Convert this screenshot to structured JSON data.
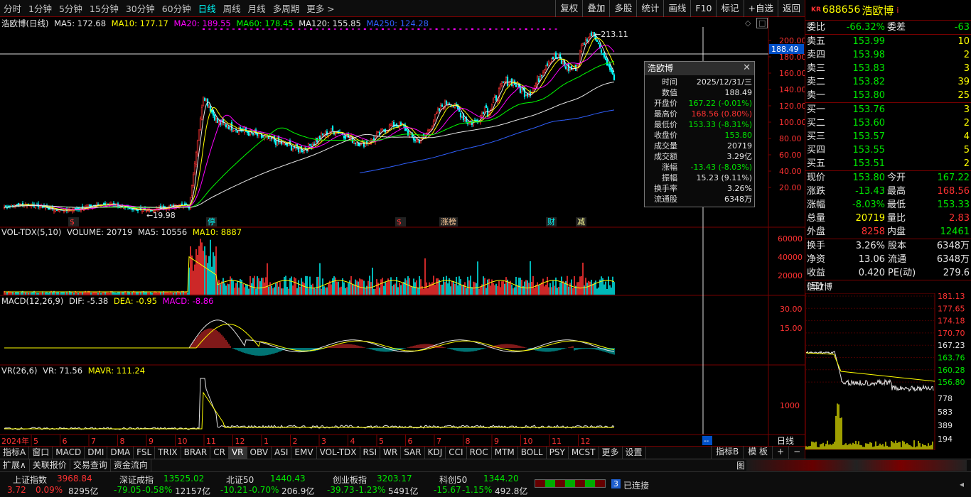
{
  "toolbar": {
    "periods": [
      "分时",
      "1分钟",
      "5分钟",
      "15分钟",
      "30分钟",
      "60分钟",
      "日线",
      "周线",
      "月线",
      "多周期",
      "更多 >"
    ],
    "active_period": "日线",
    "tools": [
      "复权",
      "叠加",
      "多股",
      "统计",
      "画线",
      "F10",
      "标记",
      "+自选",
      "返回"
    ]
  },
  "price_panel": {
    "stock_label": "浩欧博(日线)",
    "ma_labels": [
      {
        "text": "MA5: 172.68",
        "color": "#e6e6e6"
      },
      {
        "text": "MA10: 177.17",
        "color": "#ffff00"
      },
      {
        "text": "MA20: 189.55",
        "color": "#ff00ff"
      },
      {
        "text": "MA60: 178.45",
        "color": "#00ff00"
      },
      {
        "text": "MA120: 155.85",
        "color": "#e6e6e6"
      },
      {
        "text": "MA250: 124.28",
        "color": "#3060ff"
      }
    ],
    "y_ticks": [
      "200.00",
      "180.00",
      "160.00",
      "140.00",
      "120.00",
      "100.00",
      "80.00",
      "60.00",
      "40.00",
      "20.00"
    ],
    "crosshair_price": "188.49",
    "high_label": "213.11",
    "low_label": "19.98",
    "markers": [
      {
        "text": "$",
        "color": "#ff3232"
      },
      {
        "text": "停",
        "color": "#00ffff"
      },
      {
        "text": "$",
        "color": "#ff3232"
      },
      {
        "text": "涨榜",
        "color": "#ffcc99"
      },
      {
        "text": "财",
        "color": "#00ffff"
      },
      {
        "text": "减",
        "color": "#ffff99"
      }
    ]
  },
  "volume_panel": {
    "title": "VOL-TDX(5,10)",
    "labels": [
      {
        "text": "VOLUME: 20719",
        "color": "#e6e6e6"
      },
      {
        "text": "MA5: 10556",
        "color": "#e6e6e6"
      },
      {
        "text": "MA10: 8887",
        "color": "#ffff00"
      }
    ],
    "y_ticks": [
      "60000",
      "40000",
      "20000"
    ]
  },
  "macd_panel": {
    "title": "MACD(12,26,9)",
    "labels": [
      {
        "text": "DIF: -5.38",
        "color": "#e6e6e6"
      },
      {
        "text": "DEA: -0.95",
        "color": "#ffff00"
      },
      {
        "text": "MACD: -8.86",
        "color": "#ff00ff"
      }
    ],
    "y_ticks": [
      "30.00",
      "15.00"
    ]
  },
  "vr_panel": {
    "title": "VR(26,6)",
    "labels": [
      {
        "text": "VR: 71.56",
        "color": "#e6e6e6"
      },
      {
        "text": "MAVR: 111.24",
        "color": "#ffff00"
      }
    ],
    "y_ticks": [
      "1000"
    ]
  },
  "x_axis": {
    "year_label": "2024年",
    "months": [
      "5",
      "6",
      "7",
      "8",
      "9",
      "10",
      "11",
      "12",
      "1",
      "2",
      "3",
      "4",
      "5",
      "6",
      "7",
      "8",
      "9",
      "10",
      "11",
      "12"
    ],
    "period_label": "日线",
    "cursor_label": "--"
  },
  "tooltip": {
    "title": "浩欧博",
    "rows": [
      {
        "k": "时间",
        "v": "2025/12/31/三",
        "color": "#e6e6e6"
      },
      {
        "k": "数值",
        "v": "188.49",
        "color": "#e6e6e6"
      },
      {
        "k": "开盘价",
        "v": "167.22 (-0.01%)",
        "color": "#00e600"
      },
      {
        "k": "最高价",
        "v": "168.56 (0.80%)",
        "color": "#ff3232"
      },
      {
        "k": "最低价",
        "v": "153.33 (-8.31%)",
        "color": "#00e600"
      },
      {
        "k": "收盘价",
        "v": "153.80",
        "color": "#00e600"
      },
      {
        "k": "成交量",
        "v": "20719",
        "color": "#e6e6e6"
      },
      {
        "k": "成交额",
        "v": "3.29亿",
        "color": "#e6e6e6"
      },
      {
        "k": "涨幅",
        "v": "-13.43 (-8.03%)",
        "color": "#00e600"
      },
      {
        "k": "振幅",
        "v": "15.23 (9.11%)",
        "color": "#e6e6e6"
      },
      {
        "k": "换手率",
        "v": "3.26%",
        "color": "#e6e6e6"
      },
      {
        "k": "流通股",
        "v": "6348万",
        "color": "#e6e6e6"
      }
    ]
  },
  "right_panel": {
    "badge": "KR",
    "code": "688656",
    "name": "浩欧博",
    "info_icon": "i",
    "weibi": {
      "k": "委比",
      "v": "-66.32%",
      "k2": "委差",
      "v2": "-63"
    },
    "sell": [
      {
        "k": "卖五",
        "price": "153.99",
        "vol": "10"
      },
      {
        "k": "卖四",
        "price": "153.98",
        "vol": "2"
      },
      {
        "k": "卖三",
        "price": "153.83",
        "vol": "3"
      },
      {
        "k": "卖二",
        "price": "153.82",
        "vol": "39"
      },
      {
        "k": "卖一",
        "price": "153.80",
        "vol": "25"
      }
    ],
    "buy": [
      {
        "k": "买一",
        "price": "153.76",
        "vol": "3"
      },
      {
        "k": "买二",
        "price": "153.60",
        "vol": "2"
      },
      {
        "k": "买三",
        "price": "153.57",
        "vol": "4"
      },
      {
        "k": "买四",
        "price": "153.55",
        "vol": "5"
      },
      {
        "k": "买五",
        "price": "153.51",
        "vol": "2"
      }
    ],
    "quote": [
      {
        "k": "现价",
        "v": "153.80",
        "vc": "#00e600",
        "k2": "今开",
        "v2": "167.22",
        "v2c": "#00e600"
      },
      {
        "k": "涨跌",
        "v": "-13.43",
        "vc": "#00e600",
        "k2": "最高",
        "v2": "168.56",
        "v2c": "#ff3232"
      },
      {
        "k": "涨幅",
        "v": "-8.03%",
        "vc": "#00e600",
        "k2": "最低",
        "v2": "153.33",
        "v2c": "#00e600"
      },
      {
        "k": "总量",
        "v": "20719",
        "vc": "#ffff00",
        "k2": "量比",
        "v2": "2.83",
        "v2c": "#ff3232"
      },
      {
        "k": "外盘",
        "v": "8258",
        "vc": "#ff3232",
        "k2": "内盘",
        "v2": "12461",
        "v2c": "#00e600"
      }
    ],
    "stats": [
      {
        "k": "换手",
        "v": "3.26%",
        "k2": "股本",
        "v2": "6348万"
      },
      {
        "k": "净资",
        "v": "13.06",
        "k2": "流通",
        "v2": "6348万"
      },
      {
        "k": "收益(三)",
        "v": "0.420",
        "k2": "PE(动)",
        "v2": "279.6"
      }
    ],
    "mini_title": "浩欧博",
    "mini_ticks": [
      "181.13",
      "177.65",
      "174.18",
      "170.70",
      "167.23",
      "163.76",
      "160.28",
      "156.80"
    ],
    "mini_vol_ticks": [
      "778",
      "583",
      "389",
      "194"
    ]
  },
  "indicator_tabs": [
    "指标A",
    "窗口",
    "MACD",
    "DMI",
    "DMA",
    "FSL",
    "TRIX",
    "BRAR",
    "CR",
    "VR",
    "OBV",
    "ASI",
    "EMV",
    "VOL-TDX",
    "RSI",
    "WR",
    "SAR",
    "KDJ",
    "CCI",
    "ROC",
    "MTM",
    "BOLL",
    "PSY",
    "MCST",
    "更多",
    "设置"
  ],
  "indicator_tabs_right": [
    "指标B",
    "模 板",
    "+",
    "−"
  ],
  "sub_tabs": [
    "扩展∧",
    "关联报价",
    "交易查询",
    "资金流向"
  ],
  "sub_tab_right": "图",
  "status_bar": {
    "indices": [
      {
        "name": "上证指数",
        "price": "3968.84",
        "chg": "3.72",
        "pct": "0.09%",
        "amt": "8295亿",
        "color": "#ff3232"
      },
      {
        "name": "深证成指",
        "price": "13525.02",
        "chg": "-79.05",
        "pct": "-0.58%",
        "amt": "12157亿",
        "color": "#00e600"
      },
      {
        "name": "北证50",
        "price": "1440.43",
        "chg": "-10.21",
        "pct": "-0.70%",
        "amt": "206.9亿",
        "color": "#00e600"
      },
      {
        "name": "创业板指",
        "price": "3203.17",
        "chg": "-39.73",
        "pct": "-1.23%",
        "amt": "5491亿",
        "color": "#00e600"
      },
      {
        "name": "科创50",
        "price": "1344.20",
        "chg": "-15.67",
        "pct": "-1.15%",
        "amt": "492.8亿",
        "color": "#00e600"
      }
    ],
    "conn_count": "3",
    "conn_text": "已连接"
  }
}
